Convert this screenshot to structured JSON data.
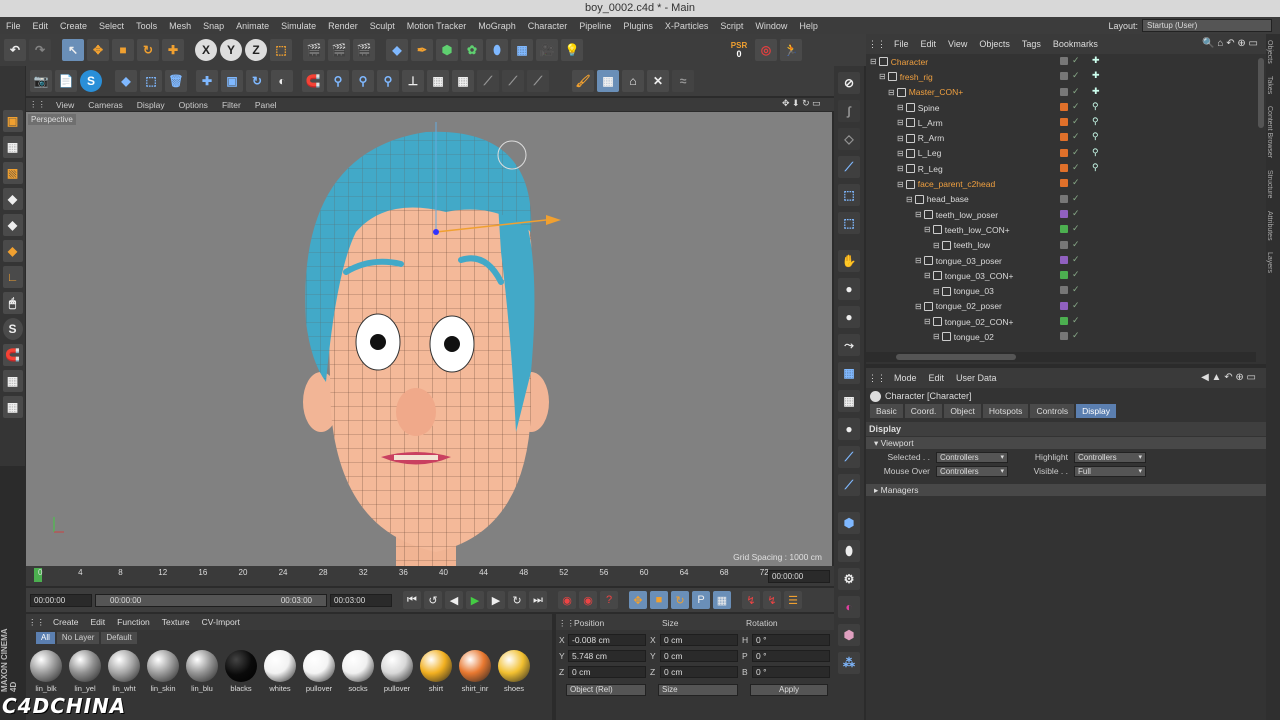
{
  "window": {
    "title": "boy_0002.c4d * - Main"
  },
  "menu": [
    "File",
    "Edit",
    "Create",
    "Select",
    "Tools",
    "Mesh",
    "Snap",
    "Animate",
    "Simulate",
    "Render",
    "Sculpt",
    "Motion Tracker",
    "MoGraph",
    "Character",
    "Pipeline",
    "Plugins",
    "X-Particles",
    "Script",
    "Window",
    "Help"
  ],
  "layout": {
    "label": "Layout:",
    "value": "Startup (User)"
  },
  "toolbar": {
    "psr_label": "PSR",
    "psr_value": "0",
    "axes": [
      "X",
      "Y",
      "Z"
    ]
  },
  "viewport": {
    "menu": [
      "View",
      "Cameras",
      "Display",
      "Options",
      "Filter",
      "Panel"
    ],
    "camera_label": "Perspective",
    "grid_spacing": "Grid Spacing : 1000 cm"
  },
  "object_manager": {
    "menu": [
      "File",
      "Edit",
      "View",
      "Objects",
      "Tags",
      "Bookmarks"
    ],
    "rows": [
      {
        "name": "Character",
        "indent": 0,
        "orange": true
      },
      {
        "name": "fresh_rig",
        "indent": 1,
        "orange": true
      },
      {
        "name": "Master_CON+",
        "indent": 2,
        "orange": true
      },
      {
        "name": "Spine",
        "indent": 3,
        "orange": false
      },
      {
        "name": "L_Arm",
        "indent": 3,
        "orange": false
      },
      {
        "name": "R_Arm",
        "indent": 3,
        "orange": false
      },
      {
        "name": "L_Leg",
        "indent": 3,
        "orange": false
      },
      {
        "name": "R_Leg",
        "indent": 3,
        "orange": false
      },
      {
        "name": "face_parent_c2head",
        "indent": 3,
        "orange": true
      },
      {
        "name": "head_base",
        "indent": 4,
        "orange": false
      },
      {
        "name": "teeth_low_poser",
        "indent": 5,
        "orange": false
      },
      {
        "name": "teeth_low_CON+",
        "indent": 6,
        "orange": false
      },
      {
        "name": "teeth_low",
        "indent": 7,
        "orange": false
      },
      {
        "name": "tongue_03_poser",
        "indent": 5,
        "orange": false
      },
      {
        "name": "tongue_03_CON+",
        "indent": 6,
        "orange": false
      },
      {
        "name": "tongue_03",
        "indent": 7,
        "orange": false
      },
      {
        "name": "tongue_02_poser",
        "indent": 5,
        "orange": false
      },
      {
        "name": "tongue_02_CON+",
        "indent": 6,
        "orange": false
      },
      {
        "name": "tongue_02",
        "indent": 7,
        "orange": false
      }
    ]
  },
  "attributes": {
    "menu": [
      "Mode",
      "Edit",
      "User Data"
    ],
    "title": "Character [Character]",
    "tabs": [
      "Basic",
      "Coord.",
      "Object",
      "Hotspots",
      "Controls",
      "Display"
    ],
    "section": "Display",
    "viewport_label": "Viewport",
    "selected_label": "Selected . .",
    "selected_value": "Controllers",
    "highlight_label": "Highlight",
    "highlight_value": "Controllers",
    "mouseover_label": "Mouse Over",
    "mouseover_value": "Controllers",
    "visible_label": "Visible . .",
    "visible_value": "Full",
    "managers_label": "Managers"
  },
  "timeline": {
    "ticks": [
      "0",
      "4",
      "8",
      "12",
      "16",
      "20",
      "24",
      "28",
      "32",
      "36",
      "40",
      "44",
      "48",
      "52",
      "56",
      "60",
      "64",
      "68",
      "72"
    ],
    "end_frame": "00:00:00"
  },
  "playback": {
    "start": "00:00:00",
    "range_start": "00:00:00",
    "range_end": "00:03:00",
    "end": "00:03:00"
  },
  "materials": {
    "menu": [
      "Create",
      "Edit",
      "Function",
      "Texture",
      "CV-Import"
    ],
    "filters": [
      "All",
      "No Layer",
      "Default"
    ],
    "items": [
      {
        "name": "lin_blk",
        "color": "#9a9a9a"
      },
      {
        "name": "lin_yel",
        "color": "#8f8f8f"
      },
      {
        "name": "lin_wht",
        "color": "#a5a5a5"
      },
      {
        "name": "lin_skin",
        "color": "#9c9c9c"
      },
      {
        "name": "lin_blu",
        "color": "#949494"
      },
      {
        "name": "blacks",
        "color": "#0a0a0a"
      },
      {
        "name": "whites",
        "color": "#f2f2f2"
      },
      {
        "name": "pullover",
        "color": "#f4f4f4"
      },
      {
        "name": "socks",
        "color": "#f0f0f0"
      },
      {
        "name": "pullover",
        "color": "#d8d8d8"
      },
      {
        "name": "shirt",
        "color": "#f2b020"
      },
      {
        "name": "shirt_inr",
        "color": "#e87830"
      },
      {
        "name": "shoes",
        "color": "#f2c030"
      }
    ]
  },
  "coordinates": {
    "headers": [
      "Position",
      "Size",
      "Rotation"
    ],
    "rows": [
      {
        "axis": "X",
        "pos": "-0.008 cm",
        "size_axis": "X",
        "size": "0 cm",
        "rot_axis": "H",
        "rot": "0 °"
      },
      {
        "axis": "Y",
        "pos": "5.748 cm",
        "size_axis": "Y",
        "size": "0 cm",
        "rot_axis": "P",
        "rot": "0 °"
      },
      {
        "axis": "Z",
        "pos": "0 cm",
        "size_axis": "Z",
        "size": "0 cm",
        "rot_axis": "B",
        "rot": "0 °"
      }
    ],
    "mode": "Object (Rel)",
    "size_mode": "Size",
    "apply": "Apply"
  },
  "right_edge_tabs": [
    "Objects",
    "Takes",
    "Content Browser",
    "Structure",
    "Attributes",
    "Layers"
  ],
  "branding": {
    "maxon": "MAXON CINEMA 4D",
    "watermark": "C4DCHINA"
  }
}
